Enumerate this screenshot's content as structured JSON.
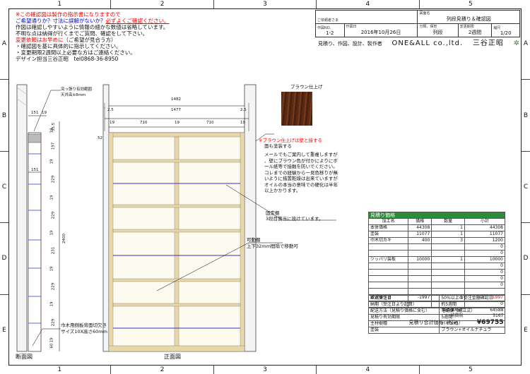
{
  "grid": {
    "cols": [
      "1",
      "2",
      "3",
      "4",
      "5"
    ],
    "rows": [
      "A",
      "B",
      "C",
      "D",
      "E"
    ]
  },
  "notes": {
    "l1": "※この確認図は製作の指示書になりますので",
    "l2a": "ご希望通りか？寸法に誤解がないか？",
    "l2b": "必ずよくご確認ください。",
    "l3": "作図は確認しやすいように情報の細かな数値は省略しています。",
    "l4": "不明な点は納得が行くまでご質問、確認をして下さい。",
    "l5a": "変更依頼はお早めに",
    "l5b": "（ご希望が見合う方）",
    "l6": "・確認図を基に具体的に指示してください。",
    "l7": "・変更期限2週間以上必要な方はご連絡ください。",
    "l8": "デザイン担当三谷正昭　tel0868-36-8950"
  },
  "title_block": {
    "client_label": "ご依頼者さま",
    "client": "",
    "drawing_label": "図面名",
    "drawing": "列段見積り＆確認図",
    "no_label": "作図NO.",
    "no": "1-2",
    "date_label": "作図日",
    "date": "2016年10月26日",
    "cat_label": "分類、保管",
    "cat": "列段",
    "period_label": "変更期限",
    "period": "2週間",
    "scale_label": "縮尺",
    "scale": "1/20",
    "company_row": "見積り、作図、設計、製作者",
    "company": "ONE&ALL co.,ltd.",
    "person": "三谷正昭"
  },
  "swatch": {
    "title": "ブラウン仕上げ"
  },
  "callouts": {
    "protrude_1": "突っ張り有効範囲",
    "protrude_2": "天井高±8mm",
    "brown_note_1": "※ブラウン仕上げは壁と接する",
    "brown_note_2": "面も塗装する",
    "mail_1": "メールでもご案内して重複しますが",
    "mail_2": "、壁にブラウン色が付かによりにボ",
    "mail_3": "ール紙等で接触を防いでください。",
    "mail_4": "コレまでの経験から一見色移りが無",
    "mail_5": "いように措置乾燥は出来ていますが",
    "mail_6": "オイルの本当の意味での硬化は半年",
    "mail_7": "以上かかります。",
    "fixed_1": "固定棚",
    "fixed_2": "3段目箇当に設けています。",
    "movable_1": "可動棚",
    "movable_2": "上下32mm間隔で移動可",
    "cut_1": "巾木用側板背面切欠き",
    "cut_2": "サイズ10X高さ60mm",
    "section_label": "断面図",
    "front_label": "正面図"
  },
  "dims": {
    "w_total": "1482",
    "w_inner": "1477",
    "gap_l": "2.5",
    "gap_r": "2.5",
    "panel_l": "19",
    "bay1": "710",
    "mid": "19",
    "bay2": "710",
    "panel_r": "19",
    "top_gap": "52",
    "height": "2400",
    "depth_a": "151",
    "depth_b": "19",
    "depth_c": "151",
    "v_segments": [
      "35.5",
      "19",
      "197",
      "19",
      "229",
      "19",
      "229",
      "19",
      "231",
      "19",
      "229",
      "19",
      "229",
      "19",
      "60"
    ]
  },
  "estimate": {
    "header": "見積り価格",
    "cols": [
      "加工名",
      "価格",
      "数量",
      "小計"
    ],
    "rows": [
      [
        "本体価格",
        "44308",
        "1",
        "44308"
      ],
      [
        "塗装",
        "11077",
        "1",
        "11077"
      ],
      [
        "巾木切カキ",
        "400",
        "3",
        "1200"
      ],
      [
        "",
        "",
        "",
        "0"
      ],
      [
        "",
        "",
        "",
        "0"
      ],
      [
        "ツッパリ装板",
        "10000",
        "1",
        "10000"
      ],
      [
        "",
        "",
        "",
        "0"
      ],
      [
        "",
        "",
        "",
        "0"
      ],
      [
        "",
        "",
        "",
        "0"
      ],
      [
        "",
        "",
        "",
        "0"
      ],
      [
        "",
        "",
        " ",
        ""
      ],
      [
        "厳選値引き",
        "-1997",
        "1",
        "-1997"
      ],
      [
        "",
        "",
        "",
        "0"
      ]
    ],
    "sum_label": "製品価格計",
    "sum": "64588",
    "tax_label": "消費税",
    "tax": "5167",
    "total_label": "見積り合計価格（税込）",
    "total": "¥69755"
  },
  "conditions": [
    [
      "正式受注日",
      "50%以上の受注金額確認日"
    ],
    [
      "納期（受注日より起算）",
      "約5週間"
    ],
    [
      "配送方法（見積り価格に含む）",
      "宅配便（組立式）"
    ],
    [
      "見積り有効期限",
      "5週間"
    ],
    [
      "主材樹種",
      "パオン材"
    ],
    [
      "塗装",
      "ブラウン+オイルナチュラ"
    ]
  ]
}
